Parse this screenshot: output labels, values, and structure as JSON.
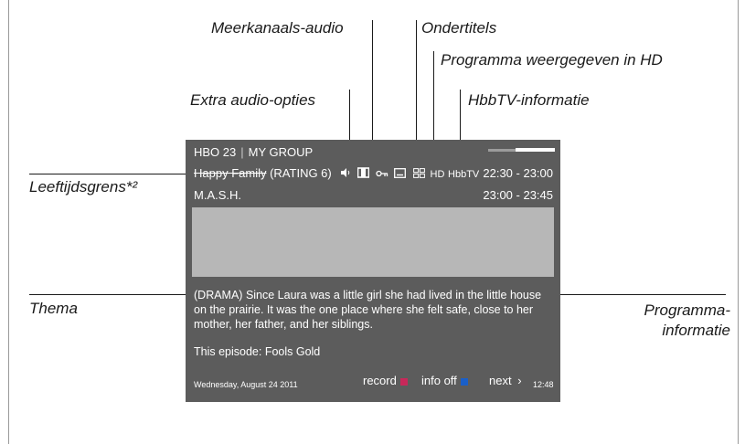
{
  "callouts": {
    "multichannel_audio": "Meerkanaals-audio",
    "subtitles": "Ondertitels",
    "hd": "Programma weergegeven in HD",
    "extra_audio": "Extra audio-opties",
    "hbbtv": "HbbTV-informatie",
    "age_limit": "Leeftijdsgrens*²",
    "theme": "Thema",
    "program_info_line1": "Programma-",
    "program_info_line2": "informatie"
  },
  "osd": {
    "channel": "HBO 23",
    "separator": "|",
    "group": "MY GROUP",
    "current_title": "Happy Family",
    "rating": "(RATING 6)",
    "hd_badge": "HD",
    "hbbtv_badge": "HbbTV",
    "current_time": "22:30 - 23:00",
    "next_title": "M.A.S.H.",
    "next_time": "23:00 - 23:45",
    "description": "(DRAMA) Since Laura was a little girl she had lived in the little house on the prairie. It was the one place where she felt safe, close to her mother, her father, and her siblings.",
    "episode": "This episode: Fools Gold",
    "date": "Wednesday, August 24 2011",
    "record_label": "record",
    "info_off_label": "info off",
    "next_label": "next",
    "next_arrow": "›",
    "clock": "12:48",
    "progress": 0.6
  },
  "colors": {
    "osd_background": "#5c5c5c",
    "preview_area": "#b7b7b7",
    "record_key": "#c8285a",
    "info_key": "#1a5fc8"
  },
  "icons": [
    "audio-options-icon",
    "multichannel-audio-icon",
    "key-icon",
    "subtitles-icon",
    "teletext-icon"
  ]
}
